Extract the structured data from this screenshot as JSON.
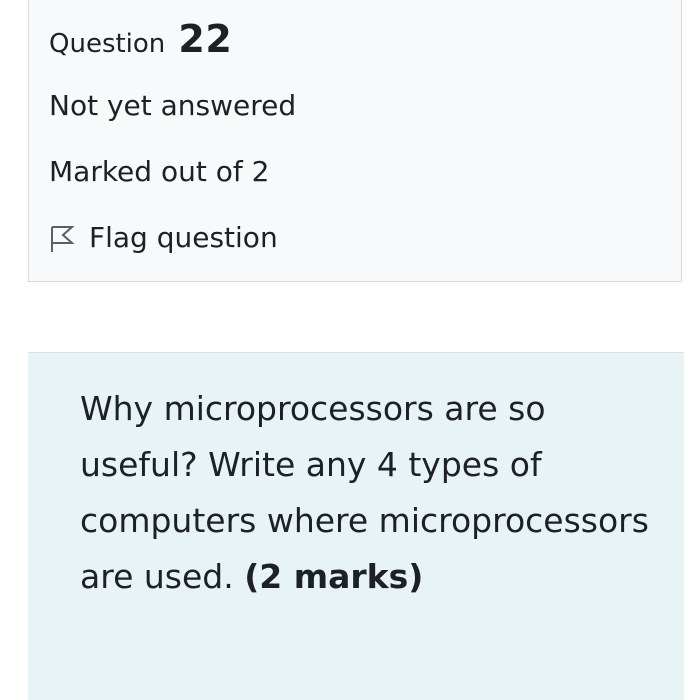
{
  "info": {
    "question_label": "Question",
    "question_number": "22",
    "state": "Not yet answered",
    "grade": "Marked out of 2",
    "flag_label": "Flag question",
    "flag_icon": "flag-outline-icon"
  },
  "question": {
    "text": "Why microprocessors are so useful? Write any 4 types of computers where microprocessors are used.",
    "marks": "(2 marks)"
  },
  "colors": {
    "info_background": "#f8f9fa",
    "info_border": "#d7dadd",
    "question_background": "#e7f3f5",
    "text": "#1d2125"
  }
}
